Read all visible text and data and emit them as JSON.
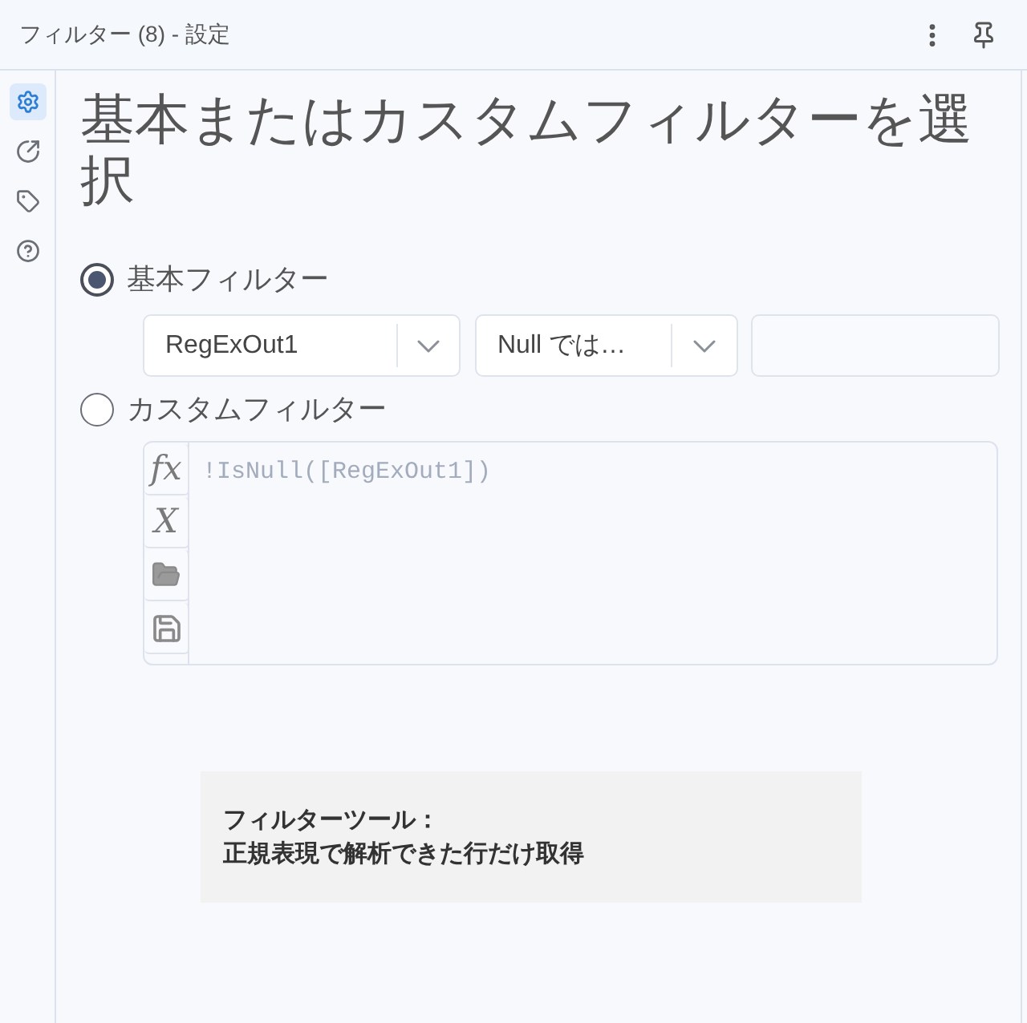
{
  "panel": {
    "title": "フィルター (8) - 設定"
  },
  "sidebar": {
    "items": [
      {
        "selected": true
      },
      {
        "selected": false
      },
      {
        "selected": false
      },
      {
        "selected": false
      }
    ]
  },
  "heading": "基本またはカスタムフィルターを選択",
  "options": [
    {
      "kind": "basic",
      "label": "基本フィルター",
      "selected": true,
      "field": "RegExOut1",
      "operator": "Null では…"
    },
    {
      "kind": "custom",
      "label": "カスタムフィルター",
      "selected": false,
      "toolbar": [
        "fx",
        "X"
      ],
      "expression": "!IsNull([RegExOut1])"
    }
  ],
  "note": {
    "lines": [
      "フィルターツール：",
      "正規表現で解析できた行だけ取得"
    ]
  }
}
